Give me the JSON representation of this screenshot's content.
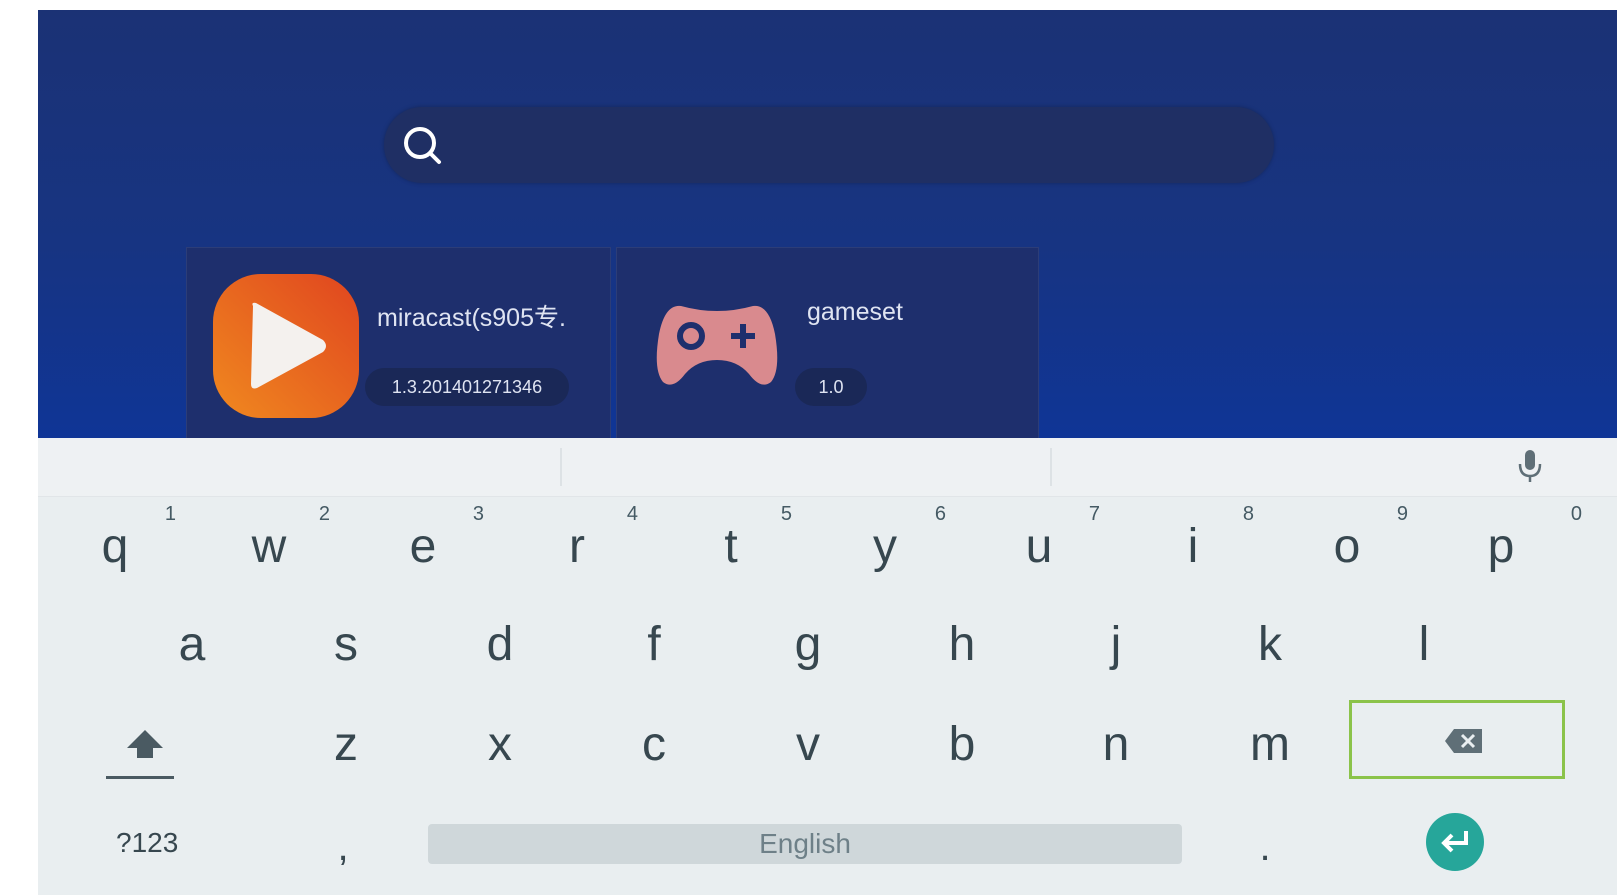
{
  "search": {
    "icon": "search-icon",
    "placeholder": ""
  },
  "apps": [
    {
      "name": "miracast(s905专.",
      "version": "1.3.201401271346",
      "icon": "play-icon"
    },
    {
      "name": "gameset",
      "version": "1.0",
      "icon": "gamepad-icon"
    }
  ],
  "keyboard": {
    "row1": [
      {
        "label": "q",
        "hint": "1"
      },
      {
        "label": "w",
        "hint": "2"
      },
      {
        "label": "e",
        "hint": "3"
      },
      {
        "label": "r",
        "hint": "4"
      },
      {
        "label": "t",
        "hint": "5"
      },
      {
        "label": "y",
        "hint": "6"
      },
      {
        "label": "u",
        "hint": "7"
      },
      {
        "label": "i",
        "hint": "8"
      },
      {
        "label": "o",
        "hint": "9"
      },
      {
        "label": "p",
        "hint": "0"
      }
    ],
    "row2": [
      "a",
      "s",
      "d",
      "f",
      "g",
      "h",
      "j",
      "k",
      "l"
    ],
    "row3": [
      "z",
      "x",
      "c",
      "v",
      "b",
      "n",
      "m"
    ],
    "symbols_label": "?123",
    "comma_label": ",",
    "space_label": "English",
    "period_label": ".",
    "icons": {
      "shift": "shift-icon",
      "backspace": "backspace-icon",
      "enter": "enter-icon",
      "mic": "mic-icon"
    },
    "colors": {
      "focus_border": "#8bc34a",
      "enter_bg": "#26a69a"
    }
  }
}
